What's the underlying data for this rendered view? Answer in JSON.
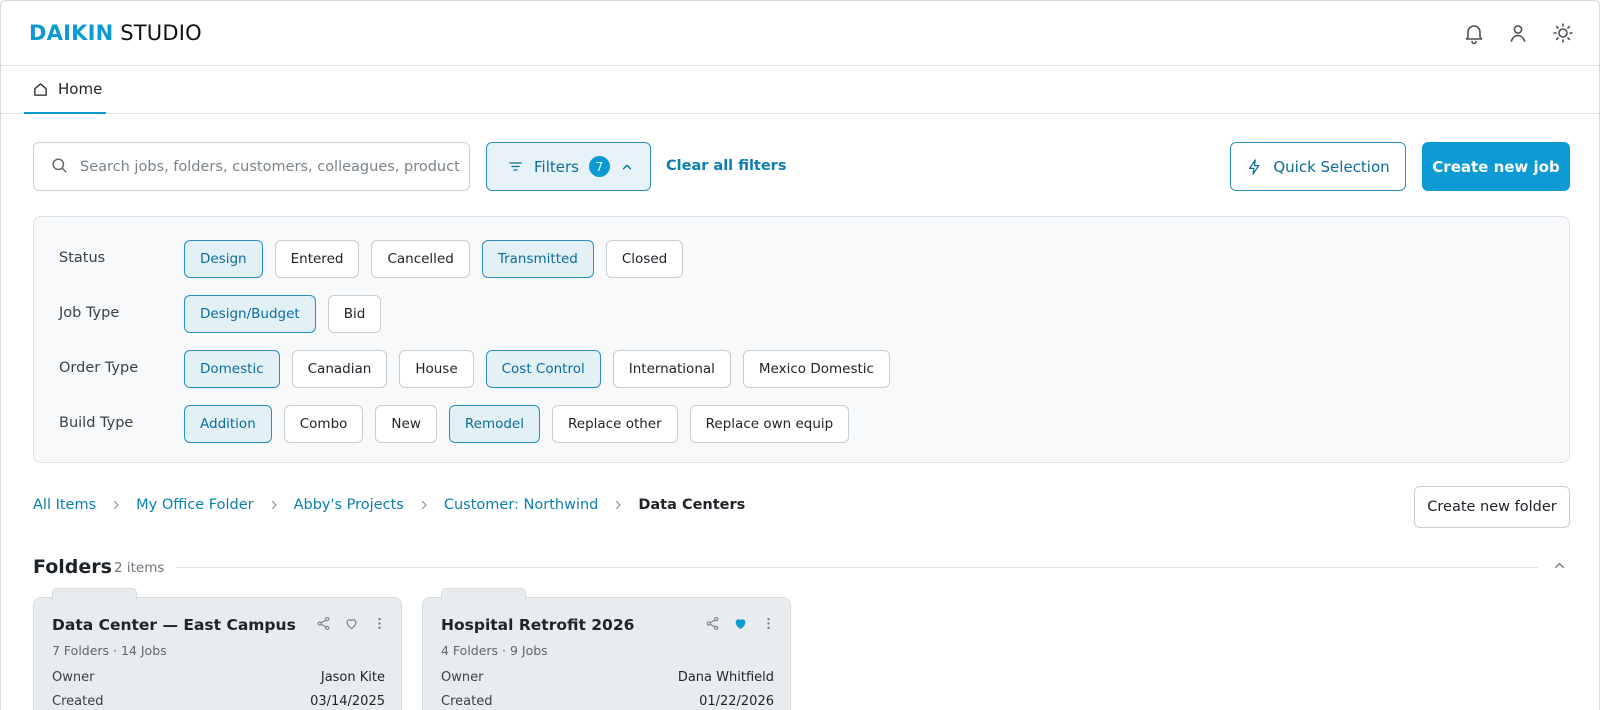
{
  "app": {
    "brand": "DAIKIN",
    "product": "STUDIO",
    "accent": "#0b9ad4"
  },
  "header_icons": [
    "bell-icon",
    "user-icon",
    "settings-sun-icon"
  ],
  "tabs": [
    {
      "label": "Home",
      "icon": "home-icon"
    }
  ],
  "search": {
    "placeholder": "Search jobs, folders, customers, colleagues, products",
    "value": ""
  },
  "toolbar": {
    "filters_label": "Filters",
    "filters_count": "7",
    "clear_label": "Clear all filters",
    "quick_label": "Quick Selection",
    "create_job_label": "Create new job"
  },
  "filters": [
    {
      "label": "Status",
      "chips": [
        {
          "label": "Design",
          "on": true
        },
        {
          "label": "Entered",
          "on": false
        },
        {
          "label": "Cancelled",
          "on": false
        },
        {
          "label": "Transmitted",
          "on": true
        },
        {
          "label": "Closed",
          "on": false
        }
      ]
    },
    {
      "label": "Job Type",
      "chips": [
        {
          "label": "Design/Budget",
          "on": true
        },
        {
          "label": "Bid",
          "on": false
        }
      ]
    },
    {
      "label": "Order Type",
      "chips": [
        {
          "label": "Domestic",
          "on": true
        },
        {
          "label": "Canadian",
          "on": false
        },
        {
          "label": "House",
          "on": false
        },
        {
          "label": "Cost Control",
          "on": true
        },
        {
          "label": "International",
          "on": false
        },
        {
          "label": "Mexico Domestic",
          "on": false
        }
      ]
    },
    {
      "label": "Build Type",
      "chips": [
        {
          "label": "Addition",
          "on": true
        },
        {
          "label": "Combo",
          "on": false
        },
        {
          "label": "New",
          "on": false
        },
        {
          "label": "Remodel",
          "on": true
        },
        {
          "label": "Replace other",
          "on": false
        },
        {
          "label": "Replace own equip",
          "on": false
        }
      ]
    }
  ],
  "breadcrumb": [
    "All Items",
    "My Office Folder",
    "Abby's Projects",
    "Customer: Northwind",
    "Data Centers"
  ],
  "create_folder_label": "Create new folder",
  "folders_section": {
    "title": "Folders",
    "count": "2 items"
  },
  "folders": [
    {
      "title": "Data Center — East Campus",
      "subtitle": "7 Folders · 14 Jobs",
      "owner_label": "Owner",
      "owner": "Jason Kite",
      "created_label": "Created",
      "created": "03/14/2025",
      "favorite": false
    },
    {
      "title": "Hospital Retrofit 2026",
      "subtitle": "4 Folders · 9 Jobs",
      "owner_label": "Owner",
      "owner": "Dana Whitfield",
      "created_label": "Created",
      "created": "01/22/2026",
      "favorite": true
    }
  ]
}
